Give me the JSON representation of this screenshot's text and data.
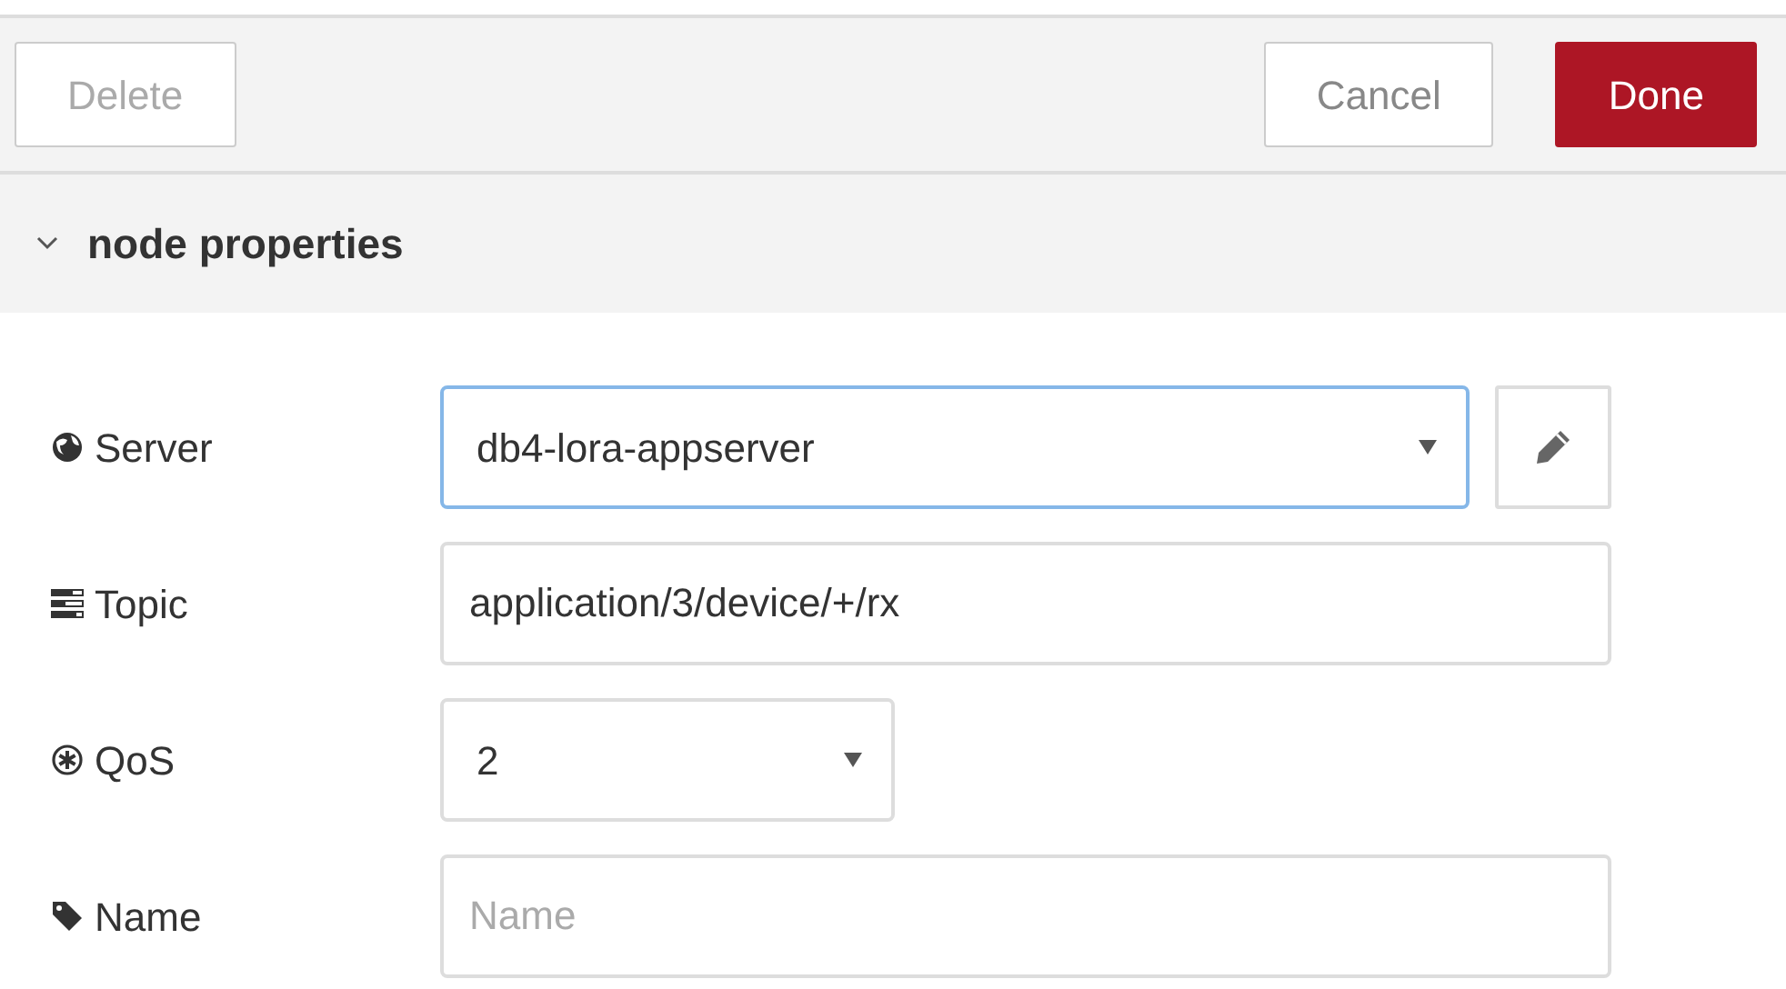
{
  "toolbar": {
    "buttons": [
      {
        "label": "Delete",
        "kind": "secondary",
        "disabled": true
      },
      {
        "label": "Cancel",
        "kind": "secondary",
        "disabled": false
      },
      {
        "label": "Done",
        "kind": "primary",
        "disabled": false
      }
    ]
  },
  "section": {
    "title": "node properties",
    "expanded": true
  },
  "fields": [
    {
      "label": "Server",
      "kind": "select",
      "value": "db4-lora-appserver",
      "focused": true,
      "wide": true,
      "side_button": {
        "kind": "edit"
      }
    },
    {
      "label": "Topic",
      "kind": "text",
      "value": "application/3/device/+/rx",
      "focused": false
    },
    {
      "label": "QoS",
      "kind": "select",
      "value": "2",
      "focused": false,
      "wide": false
    },
    {
      "label": "Name",
      "kind": "text",
      "placeholder": "Name",
      "focused": false
    }
  ]
}
